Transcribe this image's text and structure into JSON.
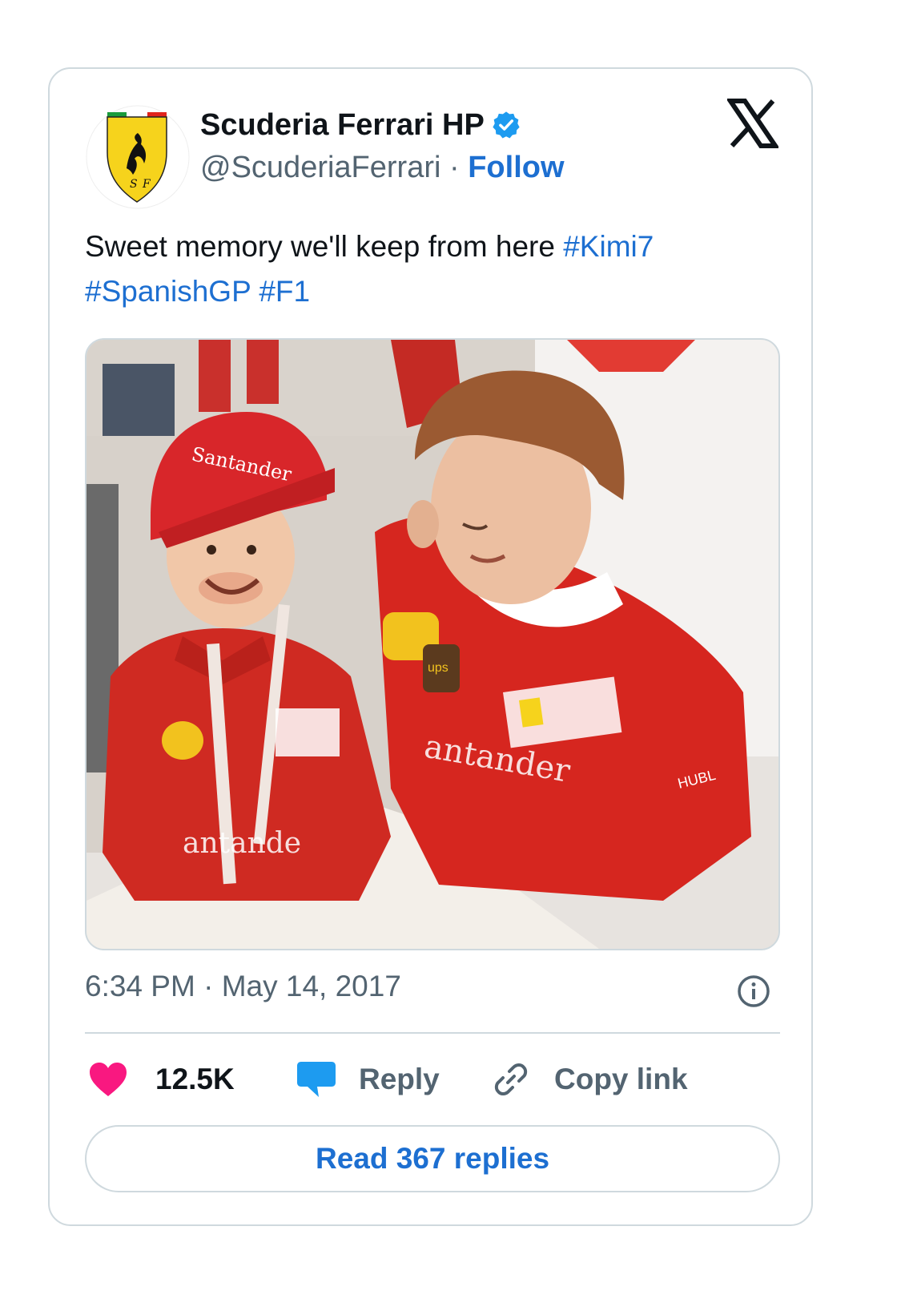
{
  "colors": {
    "accent": "#1d6fd1",
    "like": "#f91880",
    "reply": "#1d9bf0",
    "muted": "#536471",
    "border": "#cfd9de"
  },
  "author": {
    "name": "Scuderia Ferrari HP",
    "handle": "@ScuderiaFerrari",
    "separator": " · ",
    "follow_label": "Follow",
    "verified_icon": "verified-badge-icon",
    "avatar_icon": "ferrari-shield-logo"
  },
  "close_icon": "x-logo-icon",
  "tweet": {
    "text": "Sweet memory we'll keep from here ",
    "hashtags": [
      "#Kimi7",
      "#SpanishGP",
      "#F1"
    ],
    "image_icon": "tweet-photo",
    "image_text": {
      "cap": "Santander",
      "shirt_kid": "antande",
      "shirt_adult": "antander",
      "ups": "ups",
      "sponsor": "HUBL"
    },
    "time": "6:34 PM",
    "date": "May 14, 2017",
    "time_sep": " · "
  },
  "actions": {
    "likes": "12.5K",
    "reply_label": "Reply",
    "copy_label": "Copy link"
  },
  "read_replies_label": "Read 367 replies"
}
